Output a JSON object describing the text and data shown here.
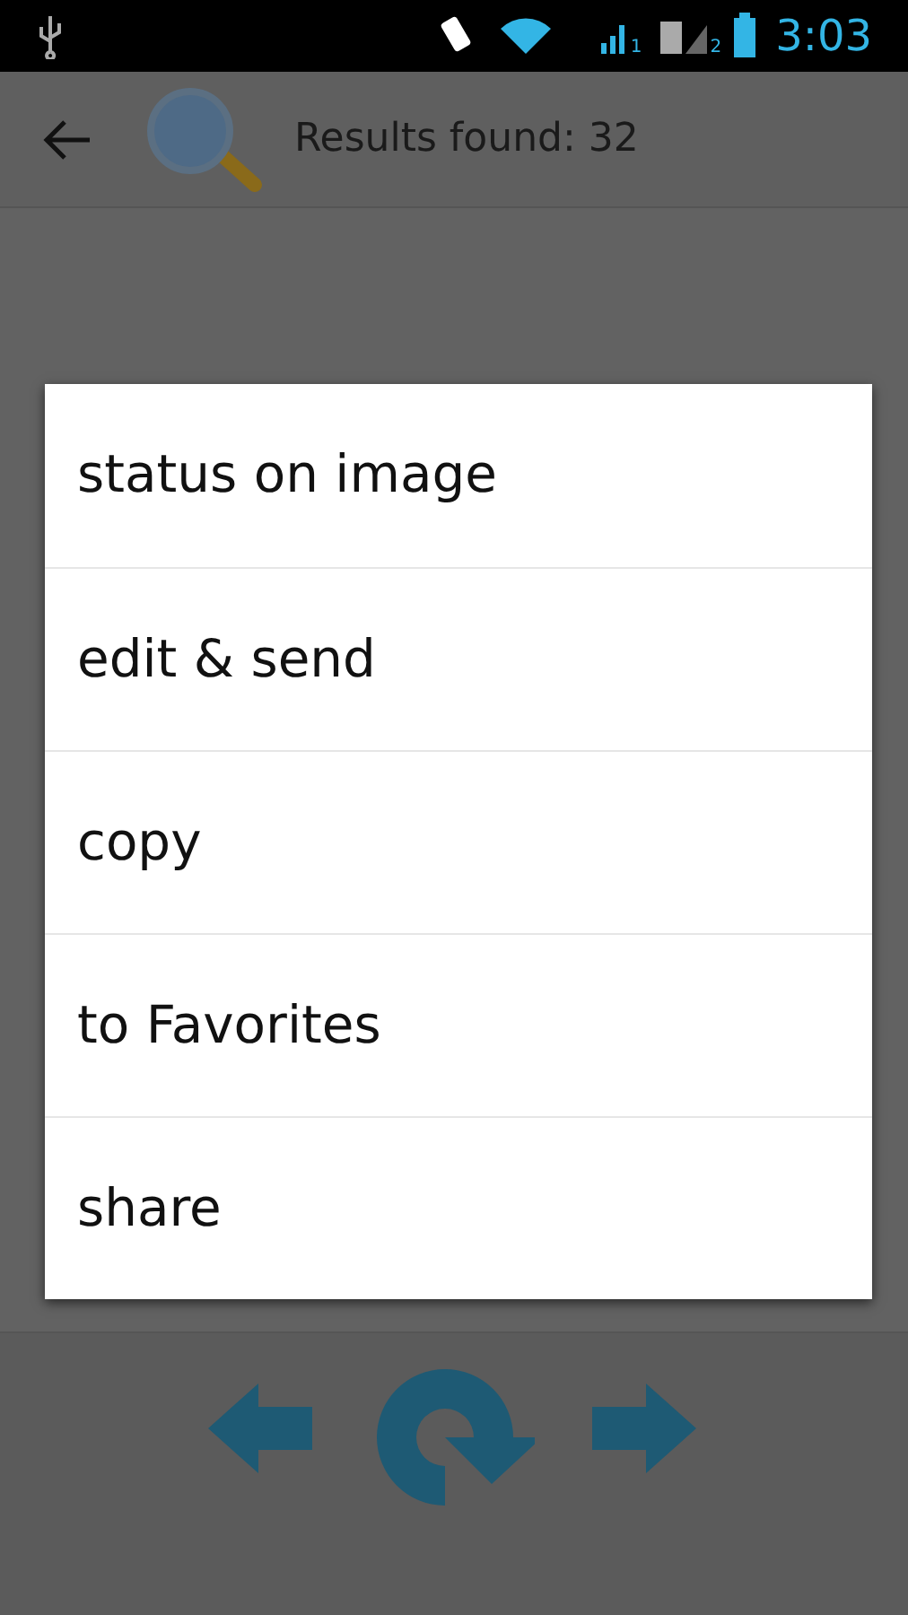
{
  "status_bar": {
    "sim_1": "1",
    "sim_2": "2",
    "time": "3:03"
  },
  "toolbar": {
    "title": "Results found: 32"
  },
  "menu": {
    "items": [
      {
        "label": "status on image"
      },
      {
        "label": "edit & send"
      },
      {
        "label": "copy"
      },
      {
        "label": "to Favorites"
      },
      {
        "label": "share"
      }
    ]
  }
}
